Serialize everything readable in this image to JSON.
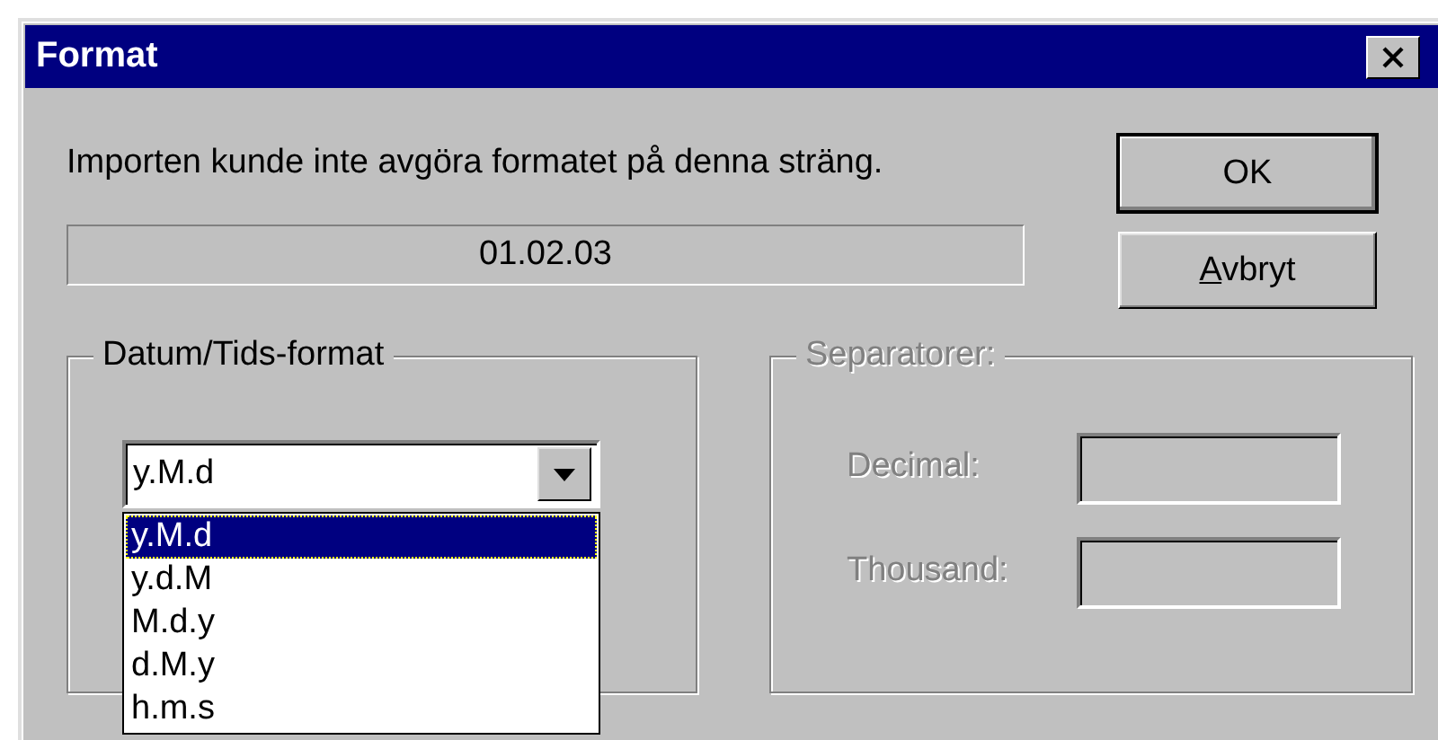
{
  "window": {
    "title": "Format"
  },
  "message": "Importen kunde inte avgöra formatet på denna sträng.",
  "value_field": {
    "value": "01.02.03"
  },
  "buttons": [
    {
      "label": "OK",
      "default": true,
      "underline_first": false
    },
    {
      "label": "Avbryt",
      "default": false,
      "underline_first": true
    }
  ],
  "date_format": {
    "label": "Datum/Tids-format",
    "combo_value": "y.M.d",
    "expanded": true,
    "options": [
      {
        "label": "y.M.d",
        "selected": true
      },
      {
        "label": "y.d.M",
        "selected": false
      },
      {
        "label": "M.d.y",
        "selected": false
      },
      {
        "label": "d.M.y",
        "selected": false
      },
      {
        "label": "h.m.s",
        "selected": false
      }
    ]
  },
  "separators": {
    "label": "Separatorer:",
    "disabled": true,
    "fields": [
      {
        "label": "Decimal:"
      },
      {
        "label": "Thousand:"
      }
    ]
  }
}
